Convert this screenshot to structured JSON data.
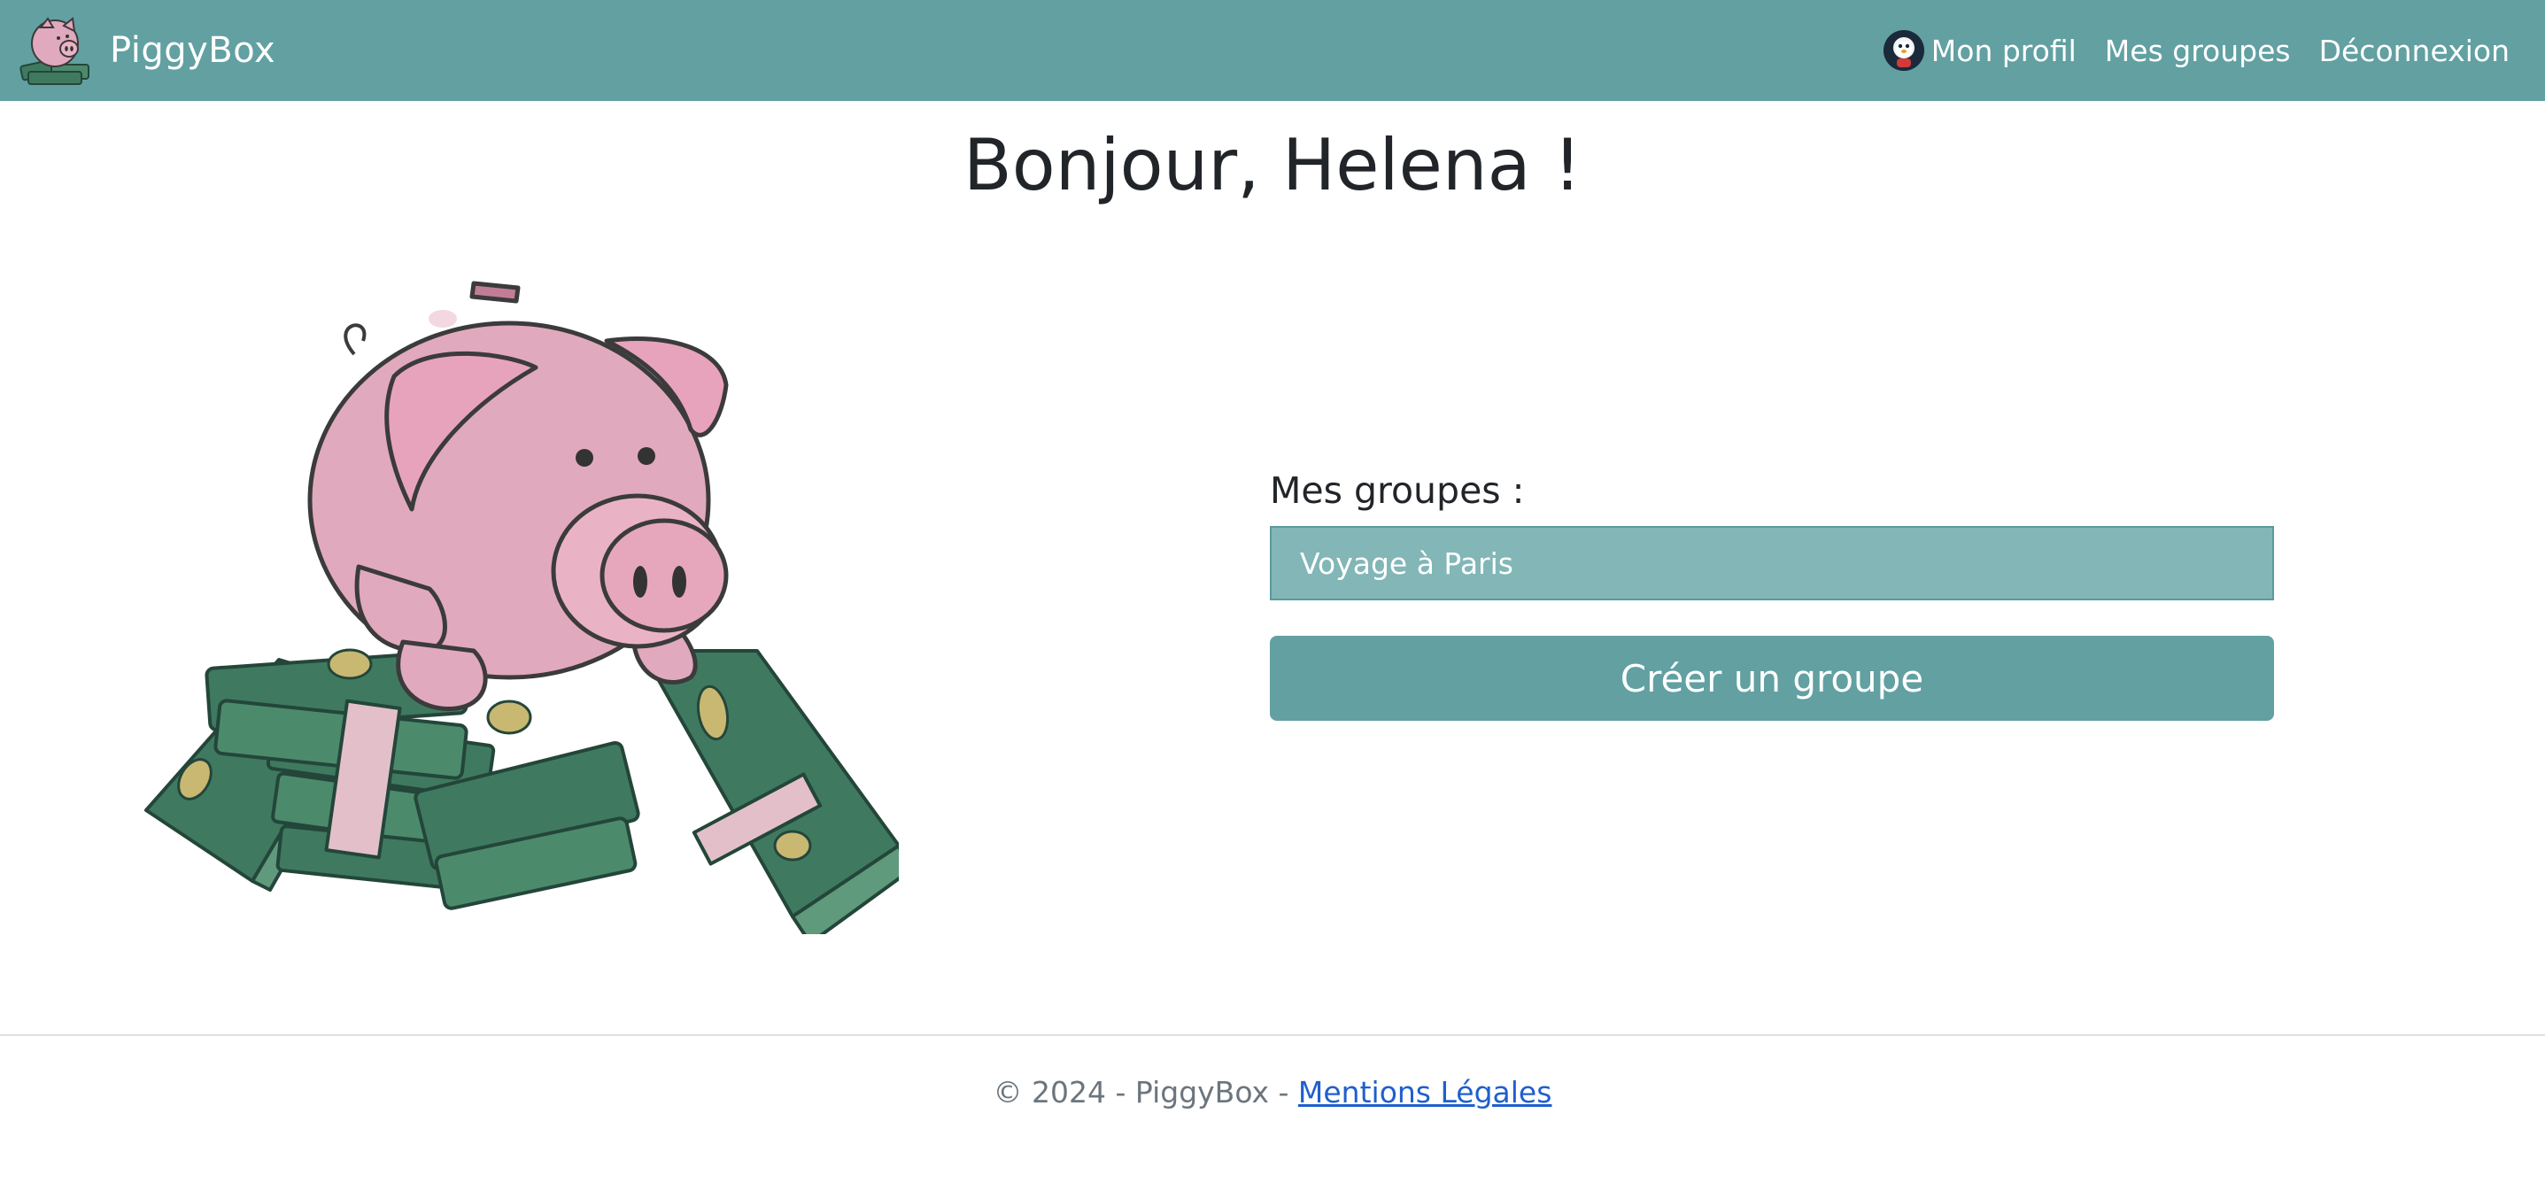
{
  "navbar": {
    "brand_name": "PiggyBox",
    "links": [
      {
        "label": "Mon profil",
        "icon": "avatar"
      },
      {
        "label": "Mes groupes"
      },
      {
        "label": "Déconnexion"
      }
    ]
  },
  "main": {
    "greeting": "Bonjour, Helena !",
    "groups_label": "Mes groupes :",
    "groups": [
      "Voyage à Paris"
    ],
    "create_button_label": "Créer un groupe"
  },
  "footer": {
    "copyright": "© 2024 - PiggyBox - ",
    "legal_link": "Mentions Légales"
  },
  "colors": {
    "navbar_bg": "#62a0a2",
    "group_item_bg": "#82b6b7",
    "button_bg": "#62a0a2",
    "link": "#1f5fcf",
    "pig_pink": "#e1a9bd",
    "money_green": "#3f7a60"
  }
}
